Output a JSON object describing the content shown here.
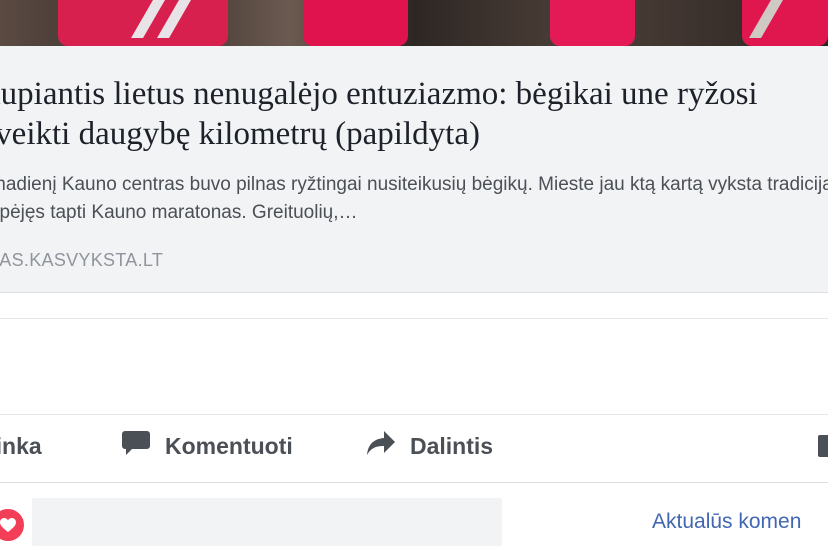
{
  "post": {
    "headline": "aupiantis lietus nenugalėjo entuziazmo: bėgikai une ryžosi įveikti daugybę kilometrų (papildyta)",
    "description": "madienį Kauno centras buvo pilnas ryžtingai nusiteikusių bėgikų. Mieste jau ktą kartą vyksta tradicija spėjęs tapti Kauno maratonas. Greituolių,…",
    "domain": "NAS.KASVYKSTA.LT"
  },
  "actions": {
    "like_label": "tinka",
    "comment_label": "Komentuoti",
    "share_label": "Dalintis"
  },
  "comments": {
    "sort_label": "Aktualūs komen",
    "reaction_icon": "heart-icon",
    "reaction_color": "#f33e58",
    "input_value": ""
  },
  "colors": {
    "card_background": "#f2f3f5",
    "link_blue": "#4267b2",
    "action_gray": "#4b4f56"
  }
}
